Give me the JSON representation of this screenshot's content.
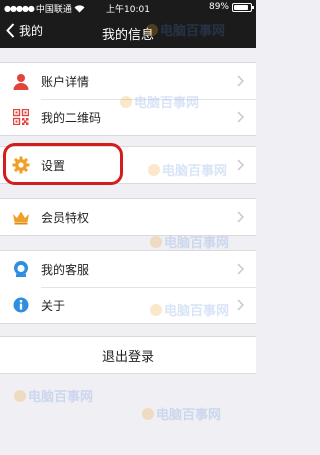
{
  "status_bar": {
    "carrier": "中国联通",
    "time": "上午10:01",
    "battery": "89%",
    "battery_level": 0.89
  },
  "nav": {
    "back_label": "我的",
    "title": "我的信息"
  },
  "groups": [
    [
      {
        "icon": "person-icon",
        "label": "账户详情"
      },
      {
        "icon": "qrcode-icon",
        "label": "我的二维码"
      }
    ],
    [
      {
        "icon": "gear-icon",
        "label": "设置"
      }
    ],
    [
      {
        "icon": "crown-icon",
        "label": "会员特权"
      }
    ],
    [
      {
        "icon": "customer-service-icon",
        "label": "我的客服"
      },
      {
        "icon": "info-icon",
        "label": "关于"
      }
    ]
  ],
  "logout_label": "退出登录",
  "watermark": "电脑百事网",
  "colors": {
    "bar": "#1b1b1b",
    "background": "#efeff4",
    "highlight": "#d41c1c",
    "icon_red": "#e0443a",
    "icon_orange": "#f0a02a",
    "icon_blue": "#2f8ee0"
  }
}
